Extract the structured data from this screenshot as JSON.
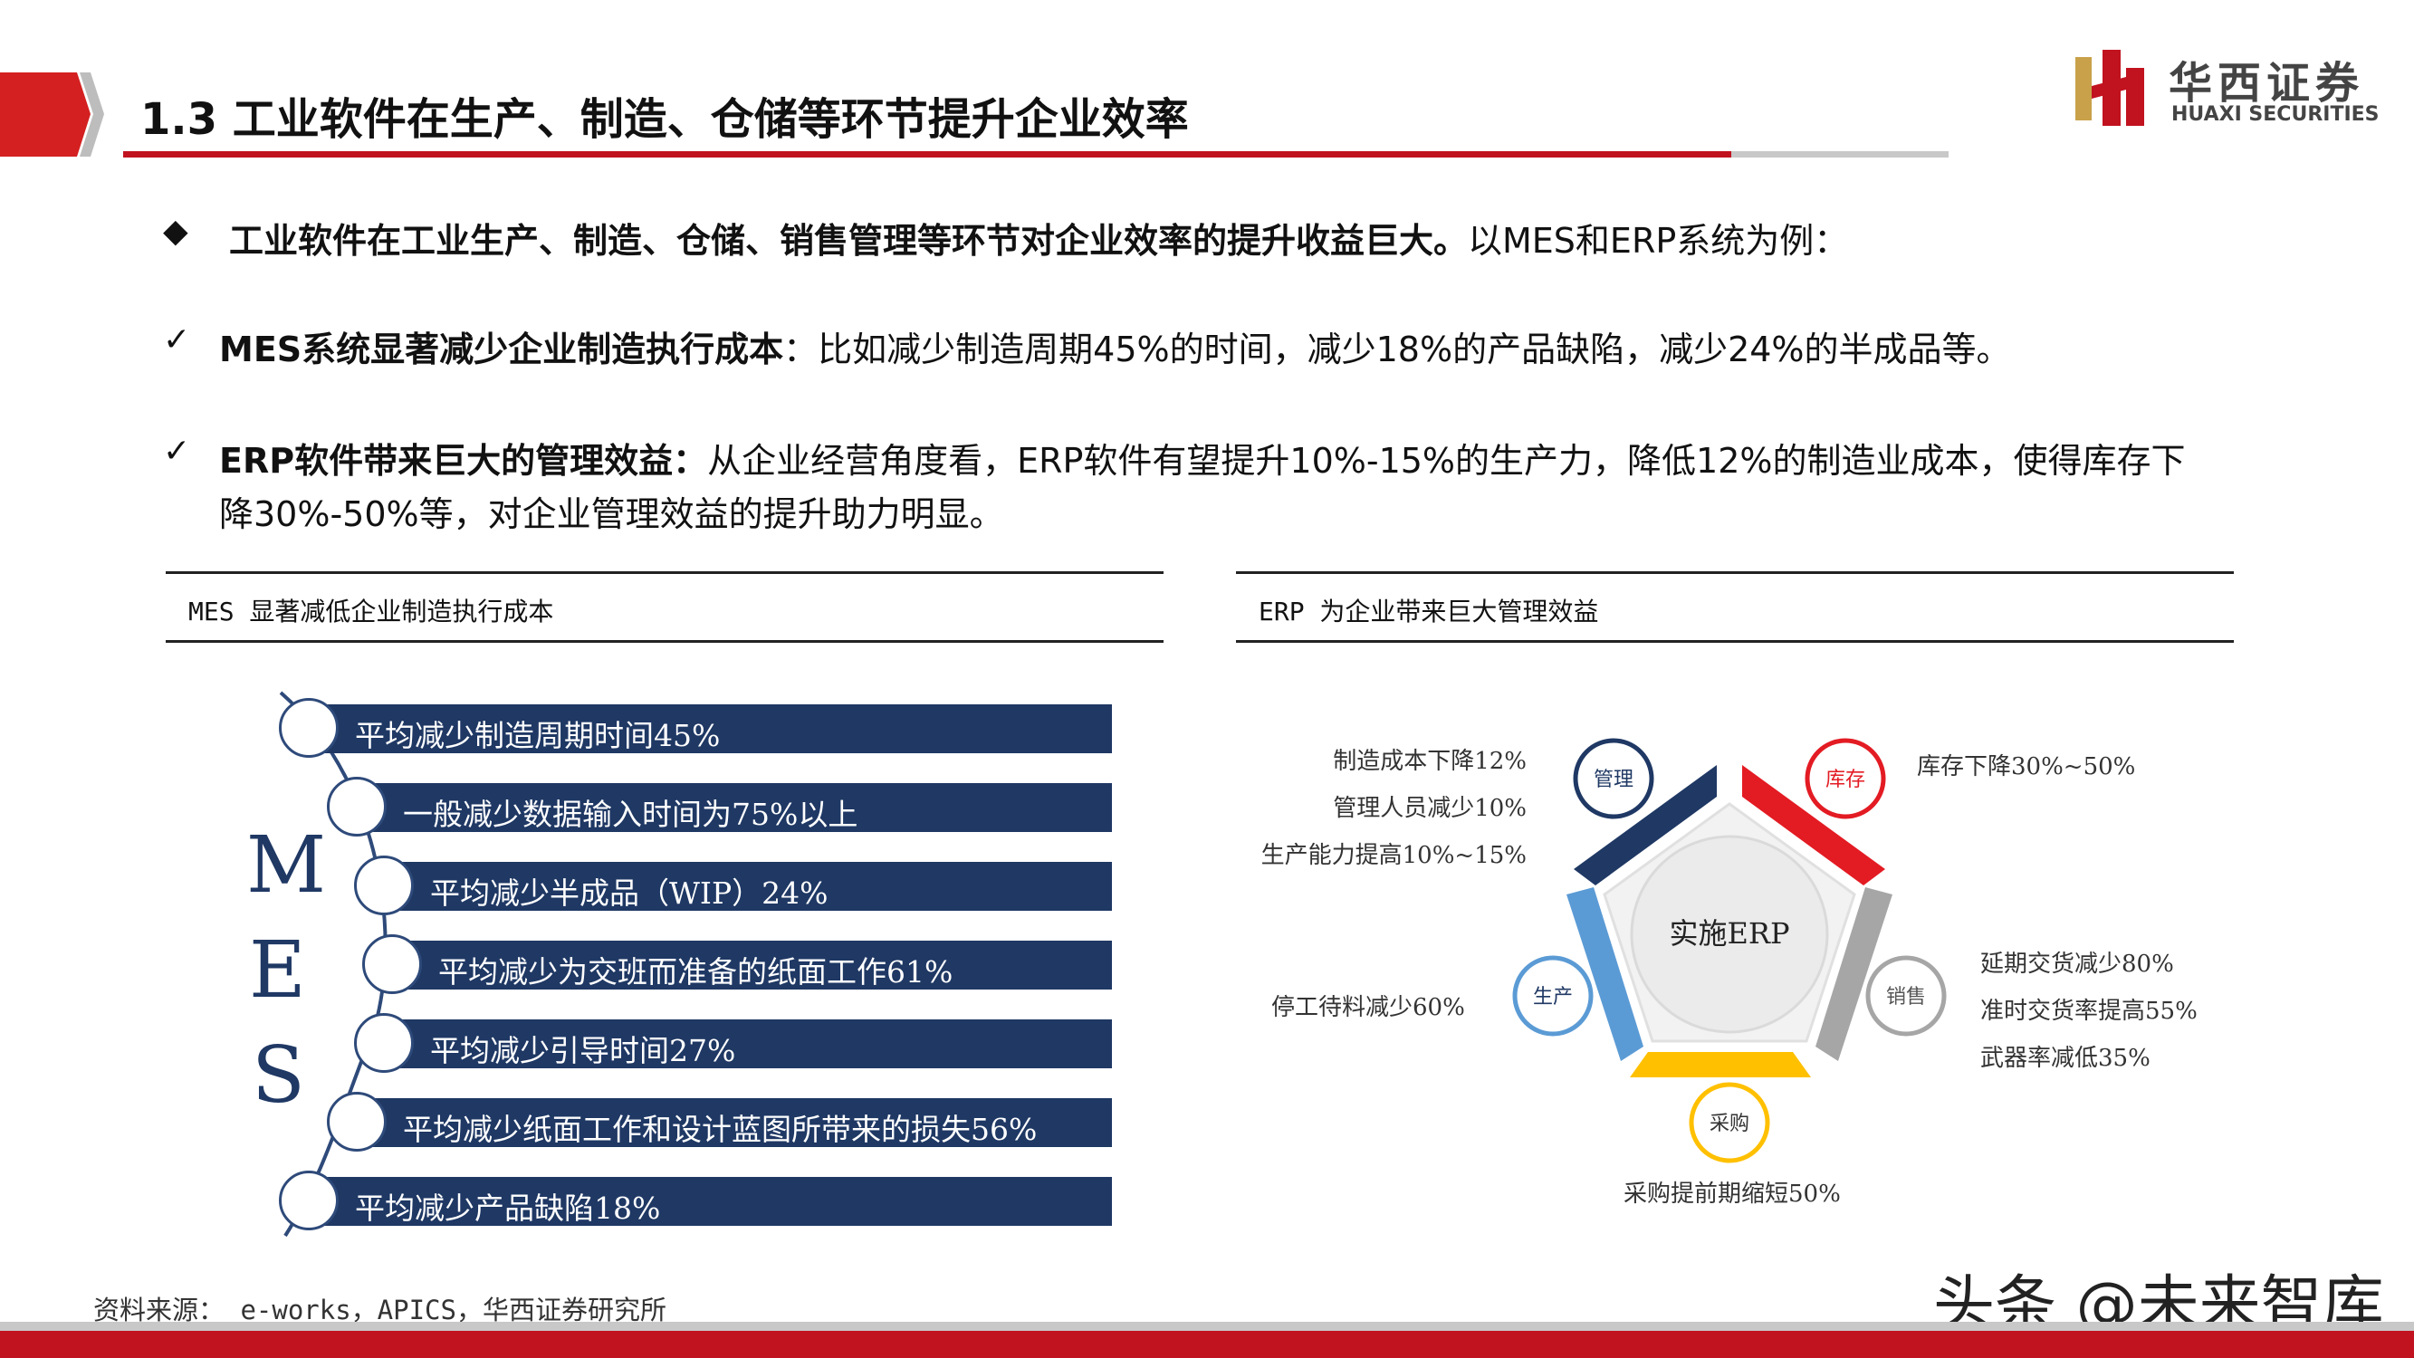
{
  "header": {
    "title": "1.3 工业软件在生产、制造、仓储等环节提升企业效率",
    "logo_cn": "华西证券",
    "logo_en": "HUAXI SECURITIES",
    "accent_color": "#c1121f"
  },
  "bullets": {
    "b0_marker": "◆",
    "b0_bold": "工业软件在工业生产、制造、仓储、销售管理等环节对企业效率的提升收益巨大。",
    "b0_rest": "以MES和ERP系统为例：",
    "b1_marker": "✓",
    "b1_bold": "MES系统显著减少企业制造执行成本",
    "b1_rest": "：比如减少制造周期45%的时间，减少18%的产品缺陷，减少24%的半成品等。",
    "b2_marker": "✓",
    "b2_bold": "ERP软件带来巨大的管理效益：",
    "b2_rest": "从企业经营角度看，ERP软件有望提升10%-15%的生产力，降低12%的制造业成本，使得库存下",
    "b2_cont": "降30%-50%等，对企业管理效益的提升助力明显。"
  },
  "mes_panel": {
    "title": "MES 显著减低企业制造执行成本",
    "letters": [
      "M",
      "E",
      "S"
    ],
    "items": [
      "平均减少制造周期时间45%",
      "一般减少数据输入时间为75%以上",
      "平均减少半成品（WIP）24%",
      "平均减少为交班而准备的纸面工作61%",
      "平均减少引导时间27%",
      "平均减少纸面工作和设计蓝图所带来的损失56%",
      "平均减少产品缺陷18%"
    ],
    "bar_color": "#1f3864"
  },
  "erp_panel": {
    "title": "ERP 为企业带来巨大管理效益",
    "center": "实施ERP",
    "nodes": {
      "manage": "管理",
      "inventory": "库存",
      "sales": "销售",
      "purchase": "采购",
      "production": "生产"
    },
    "manage_effects": [
      "制造成本下降12%",
      "管理人员减少10%",
      "生产能力提高10%~15%"
    ],
    "inventory_effects": [
      "库存下降30%~50%"
    ],
    "sales_effects": [
      "延期交货减少80%",
      "准时交货率提高55%",
      "武器率减低35%"
    ],
    "purchase_effects": [
      "采购提前期缩短50%"
    ],
    "production_effects": [
      "停工待料减少60%"
    ],
    "colors": {
      "manage": "#1f3864",
      "inventory": "#e31b23",
      "sales": "#a6a6a6",
      "purchase": "#ffc000",
      "production": "#5b9bd5"
    }
  },
  "footer": {
    "source": "资料来源： e-works，APICS，华西证券研究所",
    "watermark": "头条 @未来智库"
  }
}
